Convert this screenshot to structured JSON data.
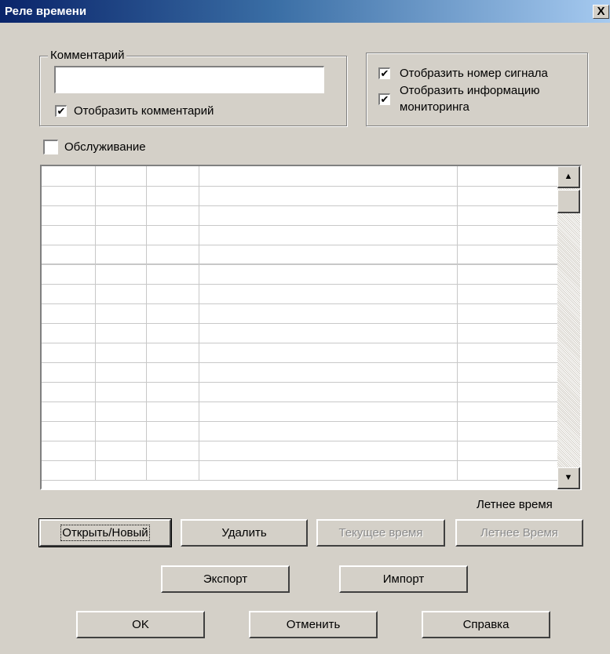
{
  "window": {
    "title": "Реле времени",
    "close_glyph": "X"
  },
  "comment_group": {
    "legend": "Комментарий",
    "input_value": "",
    "show_comment": {
      "label": "Отобразить комментарий",
      "checked": true
    }
  },
  "options_group": {
    "show_signal_number": {
      "label": "Отобразить номер сигнала",
      "checked": true
    },
    "show_monitoring_line1": "Отобразить информацию",
    "show_monitoring_line2": "мониторинга",
    "show_monitoring_checked": true
  },
  "maintenance": {
    "label": "Обслуживание",
    "checked": false
  },
  "table": {
    "rows": 16,
    "columns": 5
  },
  "scrollbar": {
    "up_glyph": "▲",
    "down_glyph": "▼"
  },
  "dst_label": "Летнее время",
  "buttons": {
    "open_new": "Открыть/Новый",
    "delete": "Удалить",
    "current_time": "Текущее время",
    "summer_time": "Летнее Время",
    "export": "Экспорт",
    "import": "Импорт",
    "ok": "OK",
    "cancel": "Отменить",
    "help": "Справка"
  },
  "colors": {
    "title_start": "#0a246a",
    "title_end": "#a6caf0",
    "face": "#d4d0c8"
  }
}
